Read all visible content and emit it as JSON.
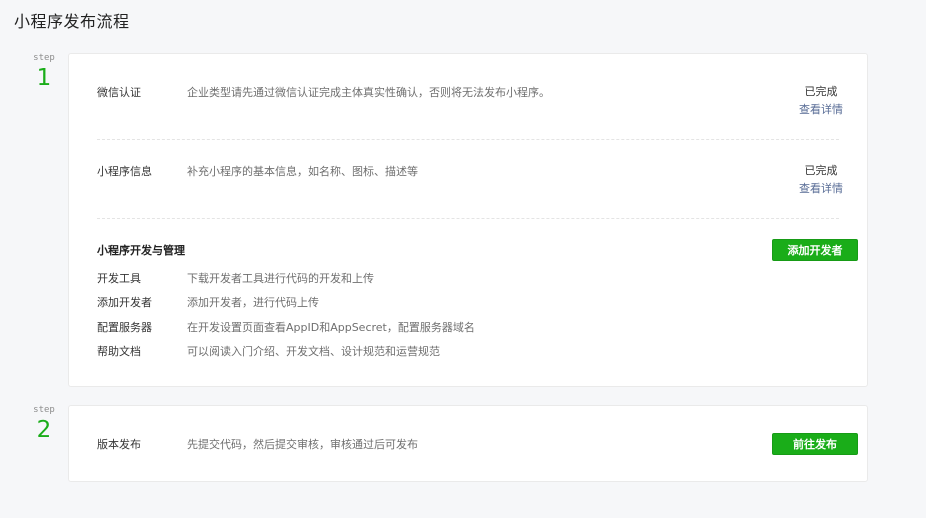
{
  "page": {
    "title": "小程序发布流程"
  },
  "step1": {
    "step_label": "step",
    "number": "1",
    "rows": [
      {
        "label": "微信认证",
        "desc": "企业类型请先通过微信认证完成主体真实性确认，否则将无法发布小程序。",
        "status": "已完成",
        "link": "查看详情"
      },
      {
        "label": "小程序信息",
        "desc": "补充小程序的基本信息，如名称、图标、描述等",
        "status": "已完成",
        "link": "查看详情"
      }
    ],
    "dev": {
      "title": "小程序开发与管理",
      "button": "添加开发者",
      "items": [
        {
          "label": "开发工具",
          "desc": "下载开发者工具进行代码的开发和上传"
        },
        {
          "label": "添加开发者",
          "desc": "添加开发者，进行代码上传"
        },
        {
          "label": "配置服务器",
          "desc": "在开发设置页面查看AppID和AppSecret，配置服务器域名"
        },
        {
          "label": "帮助文档",
          "desc": "可以阅读入门介绍、开发文档、设计规范和运营规范"
        }
      ]
    }
  },
  "step2": {
    "step_label": "step",
    "number": "2",
    "label": "版本发布",
    "desc": "先提交代码，然后提交审核，审核通过后可发布",
    "button": "前往发布"
  }
}
